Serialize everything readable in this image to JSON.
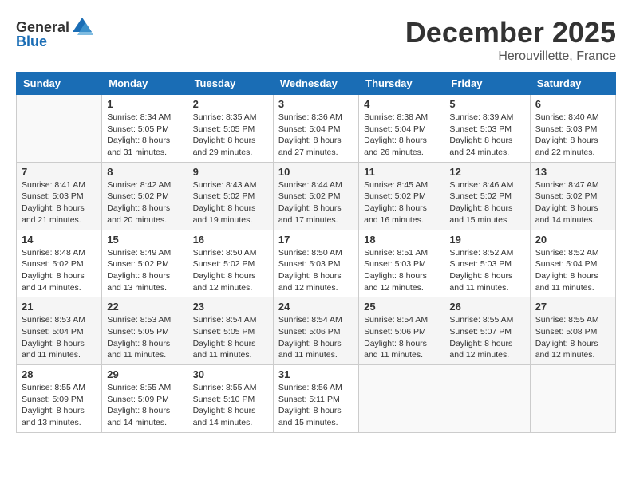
{
  "header": {
    "logo_general": "General",
    "logo_blue": "Blue",
    "month_title": "December 2025",
    "location": "Herouvillette, France"
  },
  "days_of_week": [
    "Sunday",
    "Monday",
    "Tuesday",
    "Wednesday",
    "Thursday",
    "Friday",
    "Saturday"
  ],
  "weeks": [
    [
      {
        "day": "",
        "info": ""
      },
      {
        "day": "1",
        "info": "Sunrise: 8:34 AM\nSunset: 5:05 PM\nDaylight: 8 hours\nand 31 minutes."
      },
      {
        "day": "2",
        "info": "Sunrise: 8:35 AM\nSunset: 5:05 PM\nDaylight: 8 hours\nand 29 minutes."
      },
      {
        "day": "3",
        "info": "Sunrise: 8:36 AM\nSunset: 5:04 PM\nDaylight: 8 hours\nand 27 minutes."
      },
      {
        "day": "4",
        "info": "Sunrise: 8:38 AM\nSunset: 5:04 PM\nDaylight: 8 hours\nand 26 minutes."
      },
      {
        "day": "5",
        "info": "Sunrise: 8:39 AM\nSunset: 5:03 PM\nDaylight: 8 hours\nand 24 minutes."
      },
      {
        "day": "6",
        "info": "Sunrise: 8:40 AM\nSunset: 5:03 PM\nDaylight: 8 hours\nand 22 minutes."
      }
    ],
    [
      {
        "day": "7",
        "info": "Sunrise: 8:41 AM\nSunset: 5:03 PM\nDaylight: 8 hours\nand 21 minutes."
      },
      {
        "day": "8",
        "info": "Sunrise: 8:42 AM\nSunset: 5:02 PM\nDaylight: 8 hours\nand 20 minutes."
      },
      {
        "day": "9",
        "info": "Sunrise: 8:43 AM\nSunset: 5:02 PM\nDaylight: 8 hours\nand 19 minutes."
      },
      {
        "day": "10",
        "info": "Sunrise: 8:44 AM\nSunset: 5:02 PM\nDaylight: 8 hours\nand 17 minutes."
      },
      {
        "day": "11",
        "info": "Sunrise: 8:45 AM\nSunset: 5:02 PM\nDaylight: 8 hours\nand 16 minutes."
      },
      {
        "day": "12",
        "info": "Sunrise: 8:46 AM\nSunset: 5:02 PM\nDaylight: 8 hours\nand 15 minutes."
      },
      {
        "day": "13",
        "info": "Sunrise: 8:47 AM\nSunset: 5:02 PM\nDaylight: 8 hours\nand 14 minutes."
      }
    ],
    [
      {
        "day": "14",
        "info": "Sunrise: 8:48 AM\nSunset: 5:02 PM\nDaylight: 8 hours\nand 14 minutes."
      },
      {
        "day": "15",
        "info": "Sunrise: 8:49 AM\nSunset: 5:02 PM\nDaylight: 8 hours\nand 13 minutes."
      },
      {
        "day": "16",
        "info": "Sunrise: 8:50 AM\nSunset: 5:02 PM\nDaylight: 8 hours\nand 12 minutes."
      },
      {
        "day": "17",
        "info": "Sunrise: 8:50 AM\nSunset: 5:03 PM\nDaylight: 8 hours\nand 12 minutes."
      },
      {
        "day": "18",
        "info": "Sunrise: 8:51 AM\nSunset: 5:03 PM\nDaylight: 8 hours\nand 12 minutes."
      },
      {
        "day": "19",
        "info": "Sunrise: 8:52 AM\nSunset: 5:03 PM\nDaylight: 8 hours\nand 11 minutes."
      },
      {
        "day": "20",
        "info": "Sunrise: 8:52 AM\nSunset: 5:04 PM\nDaylight: 8 hours\nand 11 minutes."
      }
    ],
    [
      {
        "day": "21",
        "info": "Sunrise: 8:53 AM\nSunset: 5:04 PM\nDaylight: 8 hours\nand 11 minutes."
      },
      {
        "day": "22",
        "info": "Sunrise: 8:53 AM\nSunset: 5:05 PM\nDaylight: 8 hours\nand 11 minutes."
      },
      {
        "day": "23",
        "info": "Sunrise: 8:54 AM\nSunset: 5:05 PM\nDaylight: 8 hours\nand 11 minutes."
      },
      {
        "day": "24",
        "info": "Sunrise: 8:54 AM\nSunset: 5:06 PM\nDaylight: 8 hours\nand 11 minutes."
      },
      {
        "day": "25",
        "info": "Sunrise: 8:54 AM\nSunset: 5:06 PM\nDaylight: 8 hours\nand 11 minutes."
      },
      {
        "day": "26",
        "info": "Sunrise: 8:55 AM\nSunset: 5:07 PM\nDaylight: 8 hours\nand 12 minutes."
      },
      {
        "day": "27",
        "info": "Sunrise: 8:55 AM\nSunset: 5:08 PM\nDaylight: 8 hours\nand 12 minutes."
      }
    ],
    [
      {
        "day": "28",
        "info": "Sunrise: 8:55 AM\nSunset: 5:09 PM\nDaylight: 8 hours\nand 13 minutes."
      },
      {
        "day": "29",
        "info": "Sunrise: 8:55 AM\nSunset: 5:09 PM\nDaylight: 8 hours\nand 14 minutes."
      },
      {
        "day": "30",
        "info": "Sunrise: 8:55 AM\nSunset: 5:10 PM\nDaylight: 8 hours\nand 14 minutes."
      },
      {
        "day": "31",
        "info": "Sunrise: 8:56 AM\nSunset: 5:11 PM\nDaylight: 8 hours\nand 15 minutes."
      },
      {
        "day": "",
        "info": ""
      },
      {
        "day": "",
        "info": ""
      },
      {
        "day": "",
        "info": ""
      }
    ]
  ]
}
